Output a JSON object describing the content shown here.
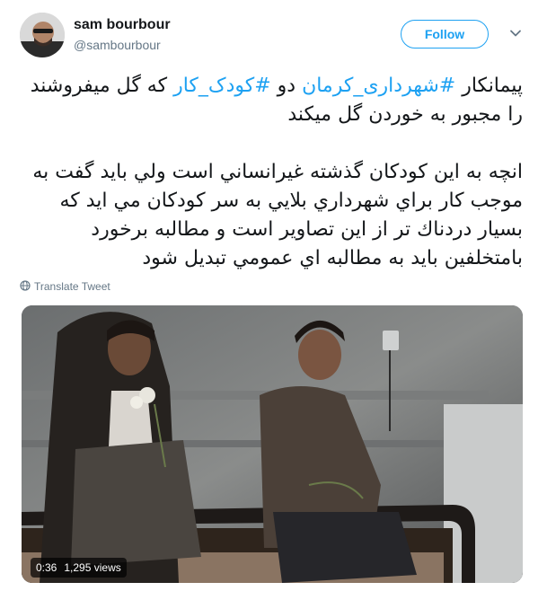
{
  "user": {
    "name": "sam bourbour",
    "handle": "@sambourbour",
    "follow_label": "Follow"
  },
  "tweet": {
    "line1_prefix": "پیمانکار ",
    "hashtag1": "#شهرداری_کرمان",
    "line1_mid": " دو  ",
    "hashtag2": "#کودک_کار",
    "line1_suffix": " که گل میفروشند را مجبور به خوردن گل میکند",
    "paragraph2": "انچه به اين كودكان گذشته غيرانساني است ولي بايد گفت به موجب كار براي شهرداري بلايي به سر كودكان مي ايد كه بسيار دردناك تر از اين تصاوير است و مطالبه برخورد بامتخلفين بايد به مطالبه اي عمومي تبديل شود"
  },
  "translate_label": "Translate Tweet",
  "video": {
    "duration": "0:36",
    "views": "1,295 views"
  },
  "colors": {
    "accent": "#1da1f2",
    "secondary_text": "#657786",
    "primary_text": "#14171a"
  },
  "icons": {
    "translate": "globe-icon",
    "menu": "chevron-down-icon"
  }
}
